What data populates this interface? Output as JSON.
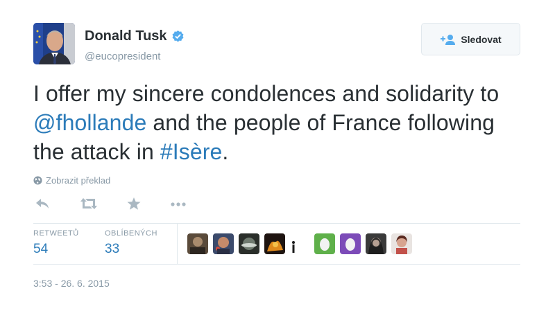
{
  "user": {
    "full_name": "Donald Tusk",
    "handle": "@eucopresident"
  },
  "follow_button": {
    "label": "Sledovat",
    "icon": "follow-user-icon"
  },
  "tweet": {
    "parts": [
      "I offer my sincere condolences and solidarity to ",
      "@fhollande",
      " and the people of France following the attack in ",
      "#Isère",
      "."
    ]
  },
  "translate": {
    "label": "Zobrazit překlad"
  },
  "actions": [
    "reply-icon",
    "retweet-icon",
    "favorite-icon",
    "more-icon"
  ],
  "stats": {
    "retweets": {
      "label": "RETWEETŮ",
      "value": "54"
    },
    "favorites": {
      "label": "OBLÍBENÝCH",
      "value": "33"
    }
  },
  "favoriters_count_shown": 9,
  "timestamp": "3:53 - 26. 6. 2015",
  "colors": {
    "text": "#292f33",
    "muted": "#8899a6",
    "link": "#2b7bb9",
    "verified": "#55acee",
    "border": "#e1e8ed"
  }
}
